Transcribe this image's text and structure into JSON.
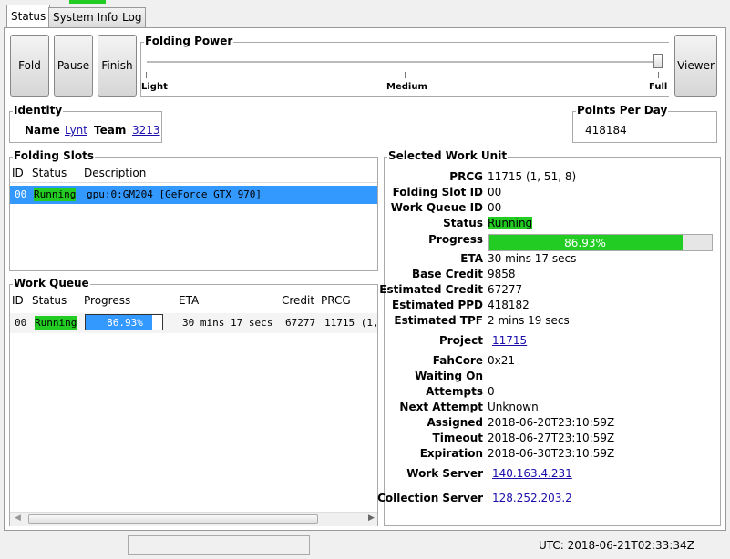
{
  "tabs": [
    "Status",
    "System Info",
    "Log"
  ],
  "buttons": {
    "fold": "Fold",
    "pause": "Pause",
    "finish": "Finish",
    "viewer": "Viewer"
  },
  "folding_power": {
    "title": "Folding Power",
    "ticks": [
      "Light",
      "Medium",
      "Full"
    ],
    "level": 1.0
  },
  "identity": {
    "title": "Identity",
    "name_label": "Name",
    "name": "Lynt",
    "team_label": "Team",
    "team": "3213"
  },
  "ppd": {
    "title": "Points Per Day",
    "value": "418184"
  },
  "slots": {
    "title": "Folding Slots",
    "headers": [
      "ID",
      "Status",
      "Description"
    ],
    "rows": [
      {
        "id": "00",
        "status": "Running",
        "description": "gpu:0:GM204 [GeForce GTX 970]"
      }
    ]
  },
  "queue": {
    "title": "Work Queue",
    "headers": [
      "ID",
      "Status",
      "Progress",
      "ETA",
      "Credit",
      "PRCG"
    ],
    "rows": [
      {
        "id": "00",
        "status": "Running",
        "progress": "86.93%",
        "progress_value": 86.93,
        "eta": "30 mins 17 secs",
        "credit": "67277",
        "prcg": "11715 (1,"
      }
    ]
  },
  "wu": {
    "title": "Selected Work Unit",
    "fields": [
      {
        "label": "PRCG",
        "value": "11715 (1, 51, 8)"
      },
      {
        "label": "Folding Slot ID",
        "value": "00"
      },
      {
        "label": "Work Queue ID",
        "value": "00"
      },
      {
        "label": "Status",
        "value": "Running"
      },
      {
        "label": "Progress",
        "value": "86.93%"
      },
      {
        "label": "ETA",
        "value": "30 mins 17 secs"
      },
      {
        "label": "Base Credit",
        "value": "9858"
      },
      {
        "label": "Estimated Credit",
        "value": "67277"
      },
      {
        "label": "Estimated PPD",
        "value": "418182"
      },
      {
        "label": "Estimated TPF",
        "value": "2 mins 19 secs"
      },
      {
        "label": "Project",
        "value": "11715"
      },
      {
        "label": "FahCore",
        "value": "0x21"
      },
      {
        "label": "Waiting On",
        "value": ""
      },
      {
        "label": "Attempts",
        "value": "0"
      },
      {
        "label": "Next Attempt",
        "value": "Unknown"
      },
      {
        "label": "Assigned",
        "value": "2018-06-20T23:10:59Z"
      },
      {
        "label": "Timeout",
        "value": "2018-06-27T23:10:59Z"
      },
      {
        "label": "Expiration",
        "value": "2018-06-30T23:10:59Z"
      },
      {
        "label": "Work Server",
        "value": "140.163.4.231"
      },
      {
        "label": "Collection Server",
        "value": "128.252.203.2"
      }
    ],
    "progress_value": 86.93
  },
  "statusbar": {
    "utc": "UTC: 2018-06-21T02:33:34Z"
  }
}
